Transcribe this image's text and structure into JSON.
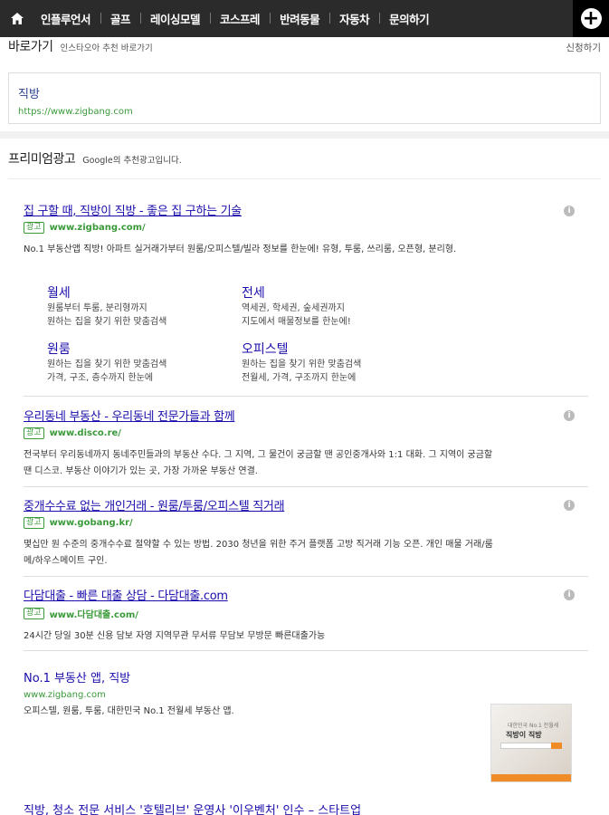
{
  "nav": {
    "items": [
      "인플루언서",
      "골프",
      "레이싱모델",
      "코스프레",
      "반려동물",
      "자동차",
      "문의하기"
    ]
  },
  "shortcuts": {
    "title": "바로가기",
    "subtitle": "인스타오아 추천 바로가기",
    "apply": "신청하기",
    "name": "직방",
    "url": "https://www.zigbang.com"
  },
  "premium": {
    "title": "프리미엄광고",
    "subtitle": "Google의 추천광고입니다."
  },
  "ads": [
    {
      "title": "집 구할 때, 직방이 직방 - 좋은 집 구하는 기술",
      "badge": "광고",
      "url": "www.zigbang.com/",
      "desc": "No.1 부동산앱 직방! 아파트 실거래가부터 원룸/오피스텔/빌라 정보를 한눈에! 유형, 투룸, 쓰리룸, 오픈형, 분리형."
    },
    {
      "title": "우리동네 부동산 - 우리동네 전문가들과 함께",
      "badge": "광고",
      "url": "www.disco.re/",
      "desc": "전국부터 우리동네까지 동네주민들과의 부동산 수다. 그 지역, 그 물건이 궁금할 땐 공인중개사와 1:1 대화. 그 지역이 궁금할 땐 디스코. 부동산 이야기가 있는 곳, 가장 가까운 부동산 연결."
    },
    {
      "title": "중개수수료 없는 개인거래 - 원룸/투룸/오피스텔 직거래",
      "badge": "광고",
      "url": "www.gobang.kr/",
      "desc": "몇십만 원 수준의 중개수수료 절약할 수 있는 방법. 2030 청년을 위한 주거 플랫폼 고방 직거래 기능 오픈. 개인 매물 거래/룸메/하우스메이트 구인."
    },
    {
      "title": "다담대출 - 빠른 대출 상담 - 다담대출.com",
      "badge": "광고",
      "url": "www.다담대출.com/",
      "desc": "24시간 당일 30분 신용 담보 자영 지역무관 무서류 무담보 무방문 빠른대출가능"
    }
  ],
  "sitelinks": [
    {
      "head": "월세",
      "l1": "원룸부터 투룸, 분리형까지",
      "l2": "원하는 집을 찾기 위한 맞춤검색"
    },
    {
      "head": "전세",
      "l1": "역세권, 학세권, 숲세권까지",
      "l2": "지도에서 매물정보를 한눈에!"
    },
    {
      "head": "원룸",
      "l1": "원하는 집을 찾기 위한 맞춤검색",
      "l2": "가격, 구조, 층수까지 한눈에"
    },
    {
      "head": "오피스텔",
      "l1": "원하는 집을 찾기 위한 맞춤검색",
      "l2": "전월세, 가격, 구조까지 한눈에"
    }
  ],
  "organic": {
    "title": "No.1 부동산 앱, 직방",
    "url": "www.zigbang.com",
    "desc": "오피스텔, 원룸, 투룸, 대한민국 No.1 전월세 부동산 앱.",
    "thumb_line1": "대한민국 No.1 전월세",
    "thumb_line2": "직방이 직방",
    "next_title": "직방, 청소 전문 서비스 '호텔리브' 운영사 '이우벤처' 인수 – 스타트업"
  },
  "icons": {
    "home": "home-icon",
    "plus": "plus-icon",
    "info": "info-icon"
  },
  "colors": {
    "nav_bg": "#2b2b2b",
    "link": "#1a0dab",
    "url_green": "#3a9a3a"
  }
}
